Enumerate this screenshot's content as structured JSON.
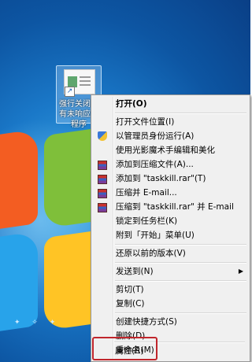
{
  "desktop": {
    "icon": {
      "label": "强行关闭所有未响应的程序"
    }
  },
  "context_menu": {
    "items": [
      {
        "label": "打开(O)",
        "bold": true,
        "icon": ""
      },
      {
        "label": "打开文件位置(I)",
        "icon": ""
      },
      {
        "label": "以管理员身份运行(A)",
        "icon": "shield-icon"
      },
      {
        "label": "使用光影魔术手编辑和美化",
        "icon": ""
      },
      {
        "label": "添加到压缩文件(A)...",
        "icon": "winrar-icon"
      },
      {
        "label": "添加到 \"taskkill.rar\"(T)",
        "icon": "winrar-icon"
      },
      {
        "label": "压缩并 E-mail...",
        "icon": "winrar-icon"
      },
      {
        "label": "压缩到 \"taskkill.rar\" 并 E-mail",
        "icon": "winrar-icon"
      },
      {
        "label": "锁定到任务栏(K)",
        "icon": ""
      },
      {
        "label": "附到「开始」菜单(U)",
        "icon": ""
      },
      {
        "label": "还原以前的版本(V)",
        "icon": ""
      },
      {
        "label": "发送到(N)",
        "icon": "",
        "submenu": true
      },
      {
        "label": "剪切(T)",
        "icon": ""
      },
      {
        "label": "复制(C)",
        "icon": ""
      },
      {
        "label": "创建快捷方式(S)",
        "icon": ""
      },
      {
        "label": "删除(D)",
        "icon": ""
      },
      {
        "label": "重命名(M)",
        "icon": ""
      },
      {
        "label": "属性(R)",
        "icon": ""
      }
    ],
    "submenu_arrow": "▶"
  },
  "colors": {
    "highlight_box": "#c0262c",
    "menu_bg": "#f0f0f0"
  }
}
